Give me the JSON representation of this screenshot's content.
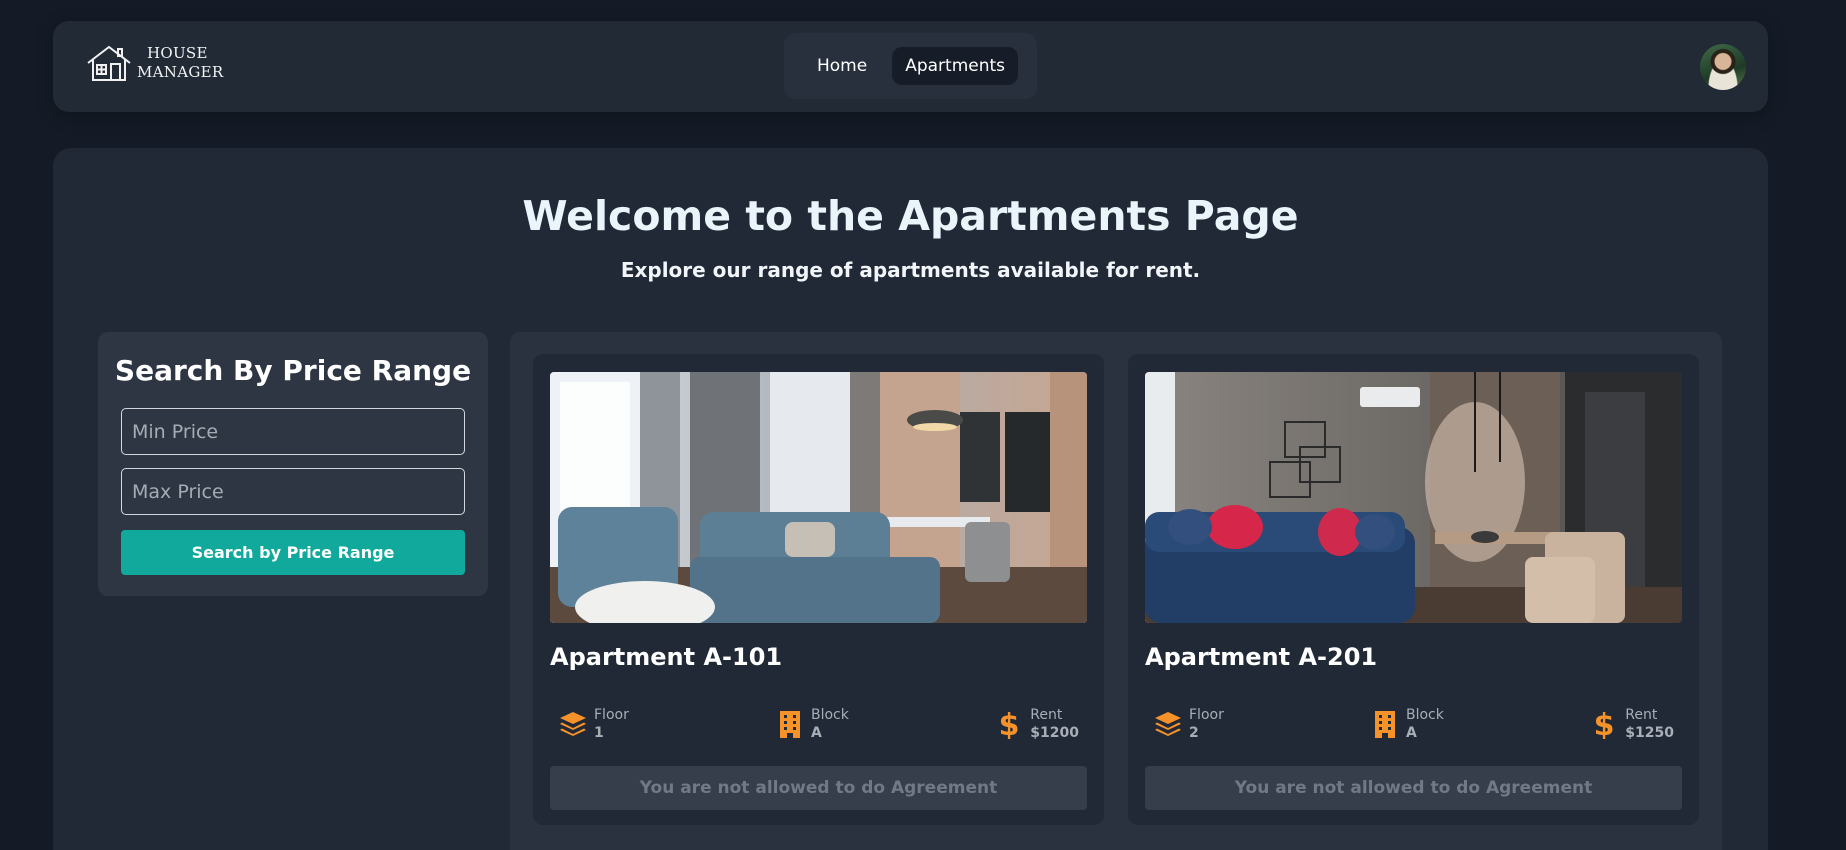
{
  "navbar": {
    "logo": {
      "line1": "HOUSE",
      "line2": "MANAGER"
    },
    "links": [
      {
        "label": "Home",
        "active": false
      },
      {
        "label": "Apartments",
        "active": true
      }
    ]
  },
  "main": {
    "title": "Welcome to the Apartments Page",
    "subtitle": "Explore our range of apartments available for rent."
  },
  "search": {
    "title": "Search By Price Range",
    "min_placeholder": "Min Price",
    "max_placeholder": "Max Price",
    "button_label": "Search by Price Range"
  },
  "apartments": [
    {
      "name": "Apartment A-101",
      "floor_label": "Floor",
      "floor": "1",
      "block_label": "Block",
      "block": "A",
      "rent_label": "Rent",
      "rent": "$1200",
      "button_label": "You are not allowed to do Agreement"
    },
    {
      "name": "Apartment A-201",
      "floor_label": "Floor",
      "floor": "2",
      "block_label": "Block",
      "block": "A",
      "rent_label": "Rent",
      "rent": "$1250",
      "button_label": "You are not allowed to do Agreement"
    }
  ],
  "colors": {
    "accent_teal": "#10a99b",
    "icon_orange": "#f5922a",
    "background": "#141b26",
    "panel": "#212936"
  },
  "icons": {
    "floor": "layers-icon",
    "block": "building-icon",
    "rent": "dollar-icon"
  }
}
